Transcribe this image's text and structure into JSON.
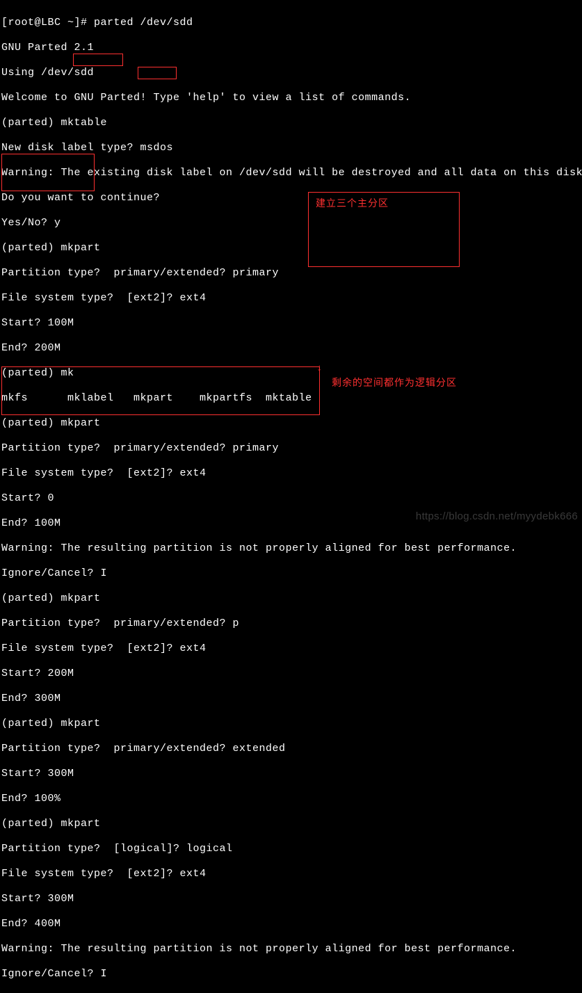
{
  "term": {
    "l00": "[root@LBC ~]# parted /dev/sdd",
    "l01": "GNU Parted 2.1",
    "l02": "Using /dev/sdd",
    "l03": "Welcome to GNU Parted! Type 'help' to view a list of commands.",
    "l04": "(parted) mktable",
    "l05": "New disk label type? msdos",
    "l06": "Warning: The existing disk label on /dev/sdd will be destroyed and all data on this disk will",
    "l07": "Do you want to continue?",
    "l08": "Yes/No? y",
    "l09": "(parted) mkpart",
    "l10": "Partition type?  primary/extended? primary",
    "l11": "File system type?  [ext2]? ext4",
    "l12": "Start? 100M",
    "l13": "End? 200M",
    "l14": "(parted) mk",
    "l15": "mkfs      mklabel   mkpart    mkpartfs  mktable",
    "l16": "(parted) mkpart",
    "l17": "Partition type?  primary/extended? primary",
    "l18": "File system type?  [ext2]? ext4",
    "l19": "Start? 0",
    "l20": "End? 100M",
    "l21": "Warning: The resulting partition is not properly aligned for best performance.",
    "l22": "Ignore/Cancel? I",
    "l23": "(parted) mkpart",
    "l24": "Partition type?  primary/extended? p",
    "l25": "File system type?  [ext2]? ext4",
    "l26": "Start? 200M",
    "l27": "End? 300M",
    "l28": "(parted) mkpart",
    "l29": "Partition type?  primary/extended? extended",
    "l30": "Start? 300M",
    "l31": "End? 100%",
    "l32": "(parted) mkpart",
    "l33": "Partition type?  [logical]? logical",
    "l34": "File system type?  [ext2]? ext4",
    "l35": "Start? 300M",
    "l36": "End? 400M",
    "l37": "Warning: The resulting partition is not properly aligned for best performance.",
    "l38": "Ignore/Cancel? I"
  },
  "annotations": {
    "a1": "建立三个主分区",
    "a2": "剩余的空间都作为逻辑分区"
  },
  "watermark": "https://blog.csdn.net/myydebk666"
}
